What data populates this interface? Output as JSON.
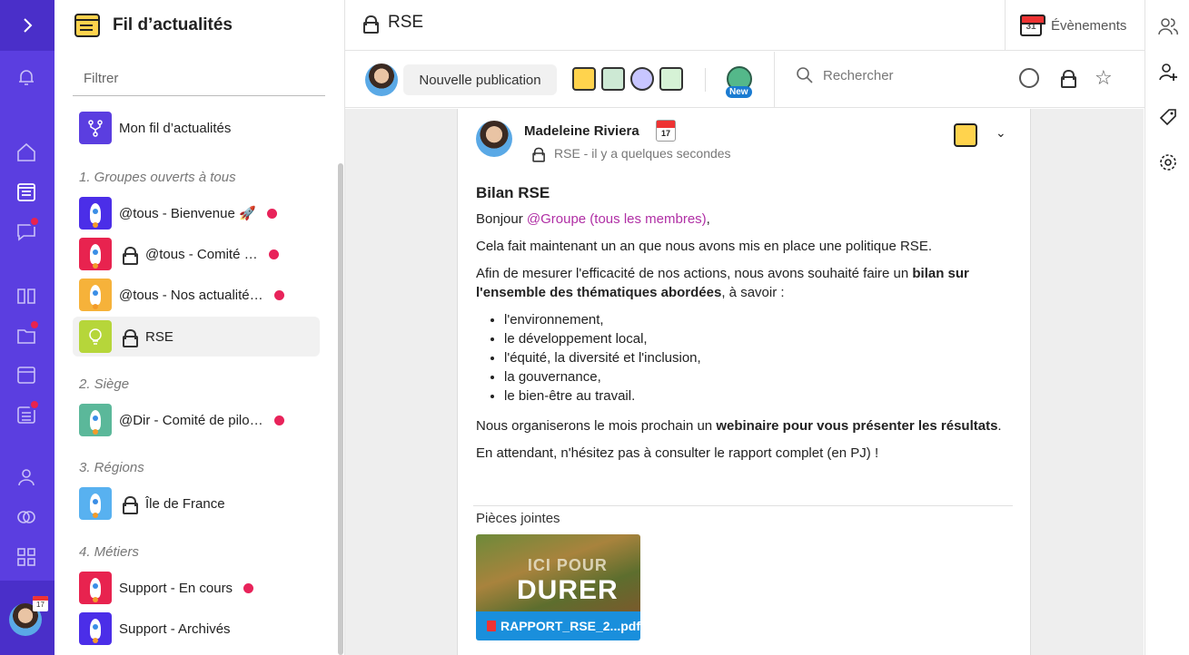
{
  "sidebar": {
    "title": "Fil d’actualités",
    "filter_placeholder": "Filtrer",
    "my_feed": "Mon fil d’actualités",
    "sections": [
      {
        "label": "1. Groupes ouverts à tous"
      },
      {
        "label": "2. Siège"
      },
      {
        "label": "3. Régions"
      },
      {
        "label": "4. Métiers"
      }
    ],
    "items": [
      {
        "label": "@tous - Bienvenue 🚀",
        "color": "#4b2ee8"
      },
      {
        "label": "@tous - Comité …",
        "color": "#e8234f"
      },
      {
        "label": "@tous - Nos actualité…",
        "color": "#f6b23a"
      },
      {
        "label": "RSE",
        "color": "#b6d63a"
      },
      {
        "label": "@Dir - Comité de pilo…",
        "color": "#5bb89a"
      },
      {
        "label": "Île de France",
        "color": "#58b1f0"
      },
      {
        "label": "Support - En cours",
        "color": "#e8234f"
      },
      {
        "label": "Support - Archivés",
        "color": "#4b2ee8"
      }
    ]
  },
  "header": {
    "title": "RSE",
    "events_label": "Évènements",
    "events_cal_day": "31"
  },
  "toolbar": {
    "new_post_label": "Nouvelle publication",
    "new_badge": "New",
    "search_placeholder": "Rechercher"
  },
  "post": {
    "author": "Madeleine Riviera",
    "cal_month": "JUL",
    "cal_day": "17",
    "meta": "RSE - il y a quelques secondes",
    "title": "Bilan RSE",
    "greeting_prefix": "Bonjour ",
    "mention": "@Groupe (tous les membres)",
    "greeting_suffix": ",",
    "p1": "Cela fait maintenant un an que nous avons mis en place une politique RSE.",
    "p2_prefix": "Afin de mesurer l'efficacité de nos actions, nous avons souhaité faire un ",
    "p2_bold": "bilan sur l'ensemble des thématiques abordées",
    "p2_suffix": ", à savoir :",
    "list": [
      "l'environnement,",
      "le développement local,",
      "l'équité, la diversité et l'inclusion,",
      "la gouvernance,",
      "le bien-être au travail."
    ],
    "p3_prefix": "Nous organiserons le mois prochain un ",
    "p3_bold": "webinaire pour vous présenter les résultats",
    "p3_suffix": ".",
    "p4": "En attendant, n'hésitez pas à consulter le rapport complet (en PJ) !",
    "attachments_label": "Pièces jointes",
    "attachment_image_line1": "ICI POUR",
    "attachment_image_line2": "DURER",
    "attachment_name": "RAPPORT_RSE_2...pdf"
  },
  "rail": {
    "avatar_cal_day": "17"
  },
  "colors": {
    "brand": "#5b3ee0",
    "notification": "#e8234f",
    "mention": "#b02fa5",
    "attachment_bar": "#1a8fdc"
  }
}
